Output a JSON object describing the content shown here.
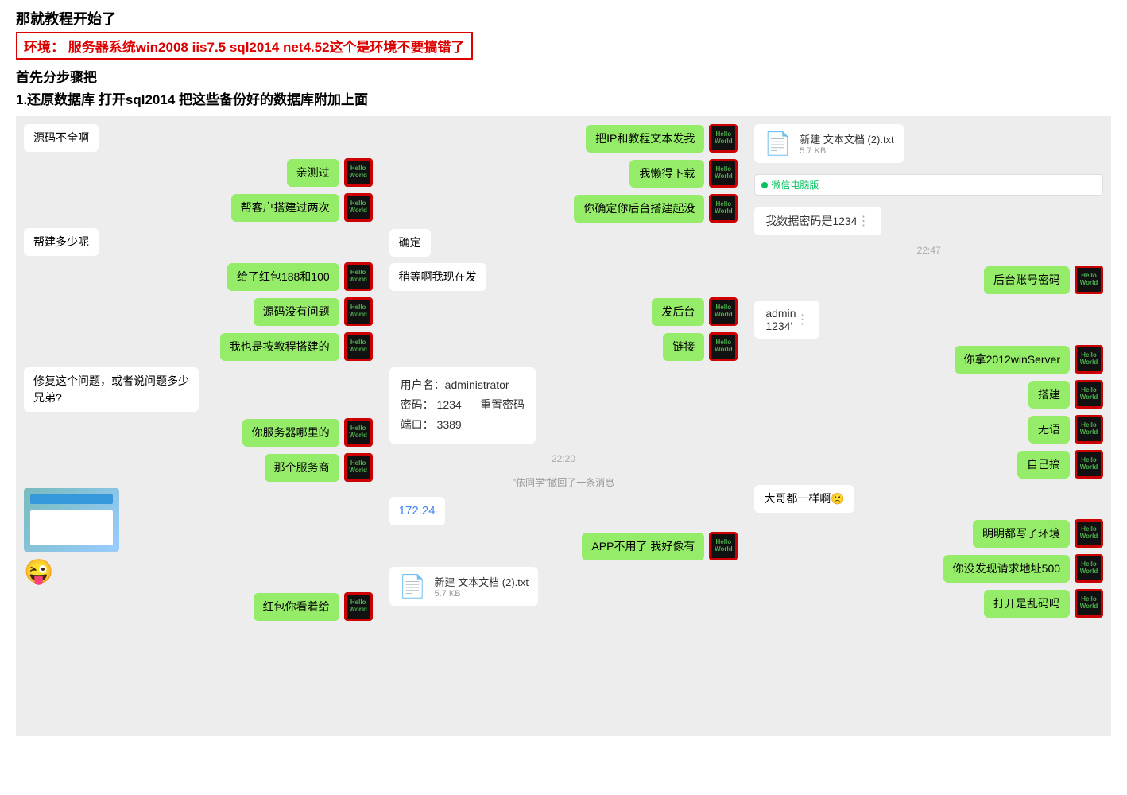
{
  "header": {
    "line1": "那就教程开始了",
    "line2": "环境：  服务器系统win2008 iis7.5 sql2014 net4.52这个是环境不要搞错了",
    "line3": "首先分步骤把",
    "line4": "1.还原数据库  打开sql2014 把这些备份好的数据库附加上面"
  },
  "col1": {
    "messages": [
      {
        "type": "left-text",
        "text": "源码不全啊"
      },
      {
        "type": "right-bubble",
        "text": "亲测过"
      },
      {
        "type": "right-bubble",
        "text": "帮客户搭建过两次"
      },
      {
        "type": "left-text",
        "text": "帮建多少呢"
      },
      {
        "type": "right-bubble",
        "text": "给了红包188和100"
      },
      {
        "type": "right-bubble",
        "text": "源码没有问题"
      },
      {
        "type": "right-bubble",
        "text": "我也是按教程搭建的"
      },
      {
        "type": "left-text",
        "text": "修复这个问题，或者说问题多少兄弟?"
      },
      {
        "type": "right-bubble",
        "text": "你服务器哪里的"
      },
      {
        "type": "right-bubble",
        "text": "那个服务商"
      },
      {
        "type": "left-thumbnail"
      },
      {
        "type": "left-emoji",
        "text": "😜"
      },
      {
        "type": "right-bubble",
        "text": "红包你看着给"
      }
    ]
  },
  "col2": {
    "messages": [
      {
        "type": "right-bubble",
        "text": "把IP和教程文本发我"
      },
      {
        "type": "right-bubble",
        "text": "我懒得下载"
      },
      {
        "type": "right-bubble",
        "text": "你确定你后台搭建起没"
      },
      {
        "type": "left-text",
        "text": "确定"
      },
      {
        "type": "left-text",
        "text": "稍等啊我现在发"
      },
      {
        "type": "right-bubble",
        "text": "发后台"
      },
      {
        "type": "right-bubble",
        "text": "链接"
      },
      {
        "type": "left-info",
        "lines": [
          "用户名：administrator",
          "密码：  1234       重置密码",
          "端口：  3389"
        ]
      },
      {
        "type": "timestamp",
        "text": "22:20"
      },
      {
        "type": "retract",
        "text": "\"依同学\"撤回了一条消息"
      },
      {
        "type": "left-bluetext",
        "text": "172.24"
      },
      {
        "type": "right-bubble",
        "text": "APP不用了 我好像有"
      },
      {
        "type": "left-file",
        "name": "新建 文本文档 (2).txt",
        "size": "5.7 KB"
      }
    ]
  },
  "col3": {
    "messages": [
      {
        "type": "top-file",
        "name": "新建 文本文档 (2).txt",
        "size": "5.7 KB"
      },
      {
        "type": "wechat-badge",
        "text": "微信电脑版"
      },
      {
        "type": "left-password",
        "text": "我数据密码是1234"
      },
      {
        "type": "timestamp",
        "text": "22:47"
      },
      {
        "type": "right-bubble",
        "text": "后台账号密码"
      },
      {
        "type": "left-admin",
        "lines": [
          "admin",
          "1234'"
        ]
      },
      {
        "type": "right-bubble",
        "text": "你拿2012winServer"
      },
      {
        "type": "right-bubble",
        "text": "搭建"
      },
      {
        "type": "right-bubble",
        "text": "无语"
      },
      {
        "type": "right-bubble",
        "text": "自己搞"
      },
      {
        "type": "left-text",
        "text": "大哥都一样啊🙁"
      },
      {
        "type": "right-bubble",
        "text": "明明都写了环境"
      },
      {
        "type": "right-bubble",
        "text": "你没发现请求地址500"
      },
      {
        "type": "right-bubble",
        "text": "打开是乱码吗"
      }
    ]
  },
  "avatarLabel": "Hello\nWorld",
  "icons": {
    "file": "📄",
    "emoji_smile": "😜",
    "emoji_face": "🙁"
  }
}
